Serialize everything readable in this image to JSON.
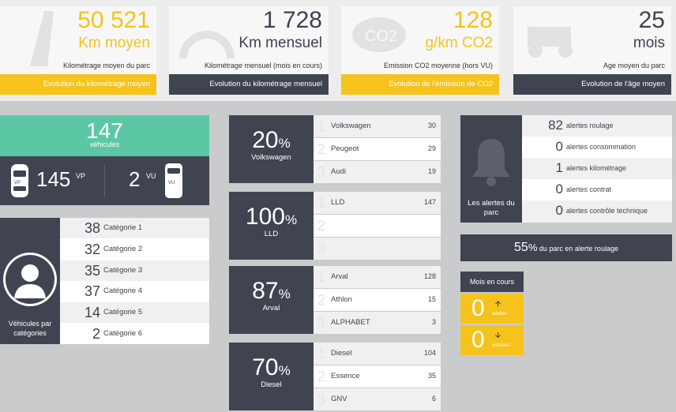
{
  "kpis": [
    {
      "value": "50 521",
      "unit": "Km moyen",
      "desc": "Kilométrage moyen du parc",
      "link": "Evolution du kilométrage moyen",
      "accent": "#f6c31c"
    },
    {
      "value": "1 728",
      "unit": "Km mensuel",
      "desc": "Kilométrage mensuel (mois en cours)",
      "link": "Evolution du kilométrage mensuel",
      "accent": "#3f4450"
    },
    {
      "value": "128",
      "unit": "g/km CO2",
      "desc": "Emission CO2 moyenne (hors VU)",
      "link": "Evolution de l'émission de CO2",
      "accent": "#f6c31c"
    },
    {
      "value": "25",
      "unit": "mois",
      "desc": "Age moyen du parc",
      "link": "Evolution de l'âge moyen",
      "accent": "#3f4450"
    }
  ],
  "co2_icon_text": "CO2",
  "vehicles": {
    "total": "147",
    "total_label": "véhicules",
    "vp": "145",
    "vp_label": "VP",
    "vp_tag": "VP",
    "vu": "2",
    "vu_label": "VU",
    "vu_tag": "VU"
  },
  "categories": {
    "label": "Véhicules par catégories",
    "items": [
      {
        "value": "38",
        "name": "Catégorie 1"
      },
      {
        "value": "32",
        "name": "Catégorie 2"
      },
      {
        "value": "35",
        "name": "Catégorie 3"
      },
      {
        "value": "37",
        "name": "Catégorie 4"
      },
      {
        "value": "14",
        "name": "Catégorie 5"
      },
      {
        "value": "2",
        "name": "Catégorie 6"
      }
    ]
  },
  "panels": [
    {
      "pct": "20",
      "sym": "%",
      "label": "Volkswagen",
      "rows": [
        {
          "i": "1",
          "name": "Volkswagen",
          "count": "30"
        },
        {
          "i": "2",
          "name": "Peugeot",
          "count": "29"
        },
        {
          "i": "3",
          "name": "Audi",
          "count": "19"
        }
      ]
    },
    {
      "pct": "100",
      "sym": "%",
      "label": "LLD",
      "rows": [
        {
          "i": "1",
          "name": "LLD",
          "count": "147"
        },
        {
          "i": "2",
          "name": "",
          "count": ""
        },
        {
          "i": "3",
          "name": "",
          "count": ""
        }
      ]
    },
    {
      "pct": "87",
      "sym": "%",
      "label": "Arval",
      "rows": [
        {
          "i": "1",
          "name": "Arval",
          "count": "128"
        },
        {
          "i": "2",
          "name": "Athlon",
          "count": "15"
        },
        {
          "i": "3",
          "name": "ALPHABET",
          "count": "3"
        }
      ]
    },
    {
      "pct": "70",
      "sym": "%",
      "label": "Diesel",
      "rows": [
        {
          "i": "1",
          "name": "Diesel",
          "count": "104"
        },
        {
          "i": "2",
          "name": "Essence",
          "count": "35"
        },
        {
          "i": "3",
          "name": "GNV",
          "count": "6"
        }
      ]
    }
  ],
  "alerts": {
    "label": "Les alertes du parc",
    "items": [
      {
        "value": "82",
        "name": "alertes roulage"
      },
      {
        "value": "0",
        "name": "alertes consommation"
      },
      {
        "value": "1",
        "name": "alertes kilométrage"
      },
      {
        "value": "0",
        "name": "alertes contrat"
      },
      {
        "value": "0",
        "name": "alertes contrôle technique"
      }
    ]
  },
  "roulage": {
    "value": "55",
    "sym": "%",
    "text": "du parc en alerte roulage"
  },
  "mois": {
    "title": "Mois en cours",
    "out_value": "0",
    "out_label": "sorties",
    "in_value": "0",
    "in_label": "entrées"
  }
}
